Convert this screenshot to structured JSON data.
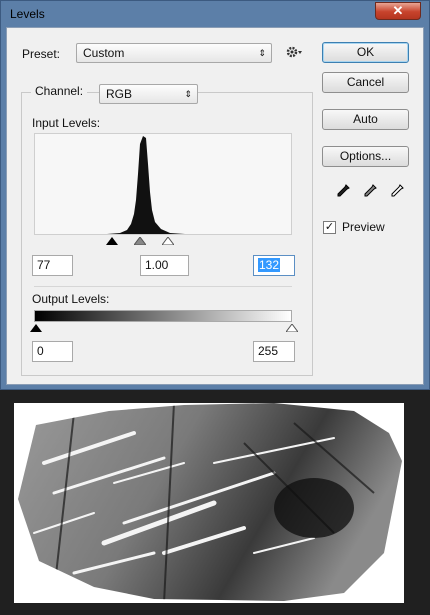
{
  "window": {
    "title": "Levels",
    "close_glyph": "✕"
  },
  "preset": {
    "label": "Preset:",
    "value": "Custom"
  },
  "buttons": {
    "ok": "OK",
    "cancel": "Cancel",
    "auto": "Auto",
    "options": "Options..."
  },
  "channel": {
    "label": "Channel:",
    "value": "RGB"
  },
  "input_levels": {
    "label": "Input Levels:",
    "black": "77",
    "gamma": "1.00",
    "white": "132"
  },
  "output_levels": {
    "label": "Output Levels:",
    "black": "0",
    "white": "255"
  },
  "preview": {
    "label": "Preview",
    "checked": true,
    "check_glyph": "✓"
  },
  "icons": {
    "preset_menu": "gear-icon",
    "eyedroppers": [
      "black-eyedropper-icon",
      "gray-eyedropper-icon",
      "white-eyedropper-icon"
    ],
    "slider_handles": [
      "black-point-slider",
      "gamma-slider",
      "white-point-slider"
    ]
  },
  "colors": {
    "titlebar": "#5c7fa8",
    "dialog_bg": "#f0f0f0",
    "close_button": "#c7432c",
    "selection": "#3399ff"
  }
}
